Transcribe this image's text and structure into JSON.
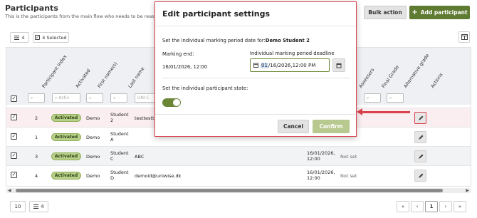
{
  "page": {
    "title": "Participants",
    "subtitle": "This is the participants from the main flow who needs to be reassessed"
  },
  "header_actions": {
    "bulk_label": "Bulk action",
    "add_label": "Add participant",
    "add_icon": "plus-icon"
  },
  "toolbar": {
    "columns_count": "4",
    "selected_label": "4 Selected"
  },
  "columns": [
    "Participant index",
    "Activated",
    "First name(s)",
    "Last name",
    "Assessors",
    "Final Grade",
    "Alternative grade",
    "Actions"
  ],
  "filters": {
    "activated_placeholder": "Activ",
    "lastname_placeholder": "UNI-C"
  },
  "rows": [
    {
      "index": "2",
      "status": "Activated",
      "first": "Demo",
      "last": "Student 2",
      "email": "testtestt",
      "date": "",
      "assessor": ""
    },
    {
      "index": "1",
      "status": "Activated",
      "first": "Demo",
      "last": "Student A",
      "email": "",
      "date": "",
      "assessor": ""
    },
    {
      "index": "3",
      "status": "Activated",
      "first": "Demo",
      "last": "Student C",
      "email": "ABC",
      "date": "16/01/2026, 12:00",
      "assessor": "Not set"
    },
    {
      "index": "4",
      "status": "Activated",
      "first": "Demo",
      "last": "Student D",
      "email": "demoid@uniwise.dk",
      "date": "16/01/2026, 12:00",
      "assessor": "Not set"
    }
  ],
  "pagination": {
    "page_size": "10",
    "count": "4",
    "current_page": "1"
  },
  "dialog": {
    "title": "Edit participant settings",
    "intro_prefix": "Set the individual marking period date for:",
    "intro_name": "Demo Student 2",
    "marking_end_label": "Marking end:",
    "marking_end_value": "16/01/2026, 12:00",
    "deadline_label": "Individual marking period deadline",
    "deadline_day": "01",
    "deadline_rest": "/16/2026,12:00 PM",
    "state_label": "Set the individual participant state:",
    "state_on": true,
    "cancel_label": "Cancel",
    "confirm_label": "Confirm"
  },
  "colors": {
    "accent": "#5f7a31",
    "highlight": "#d8424c",
    "status_bg": "#b9d08a"
  }
}
